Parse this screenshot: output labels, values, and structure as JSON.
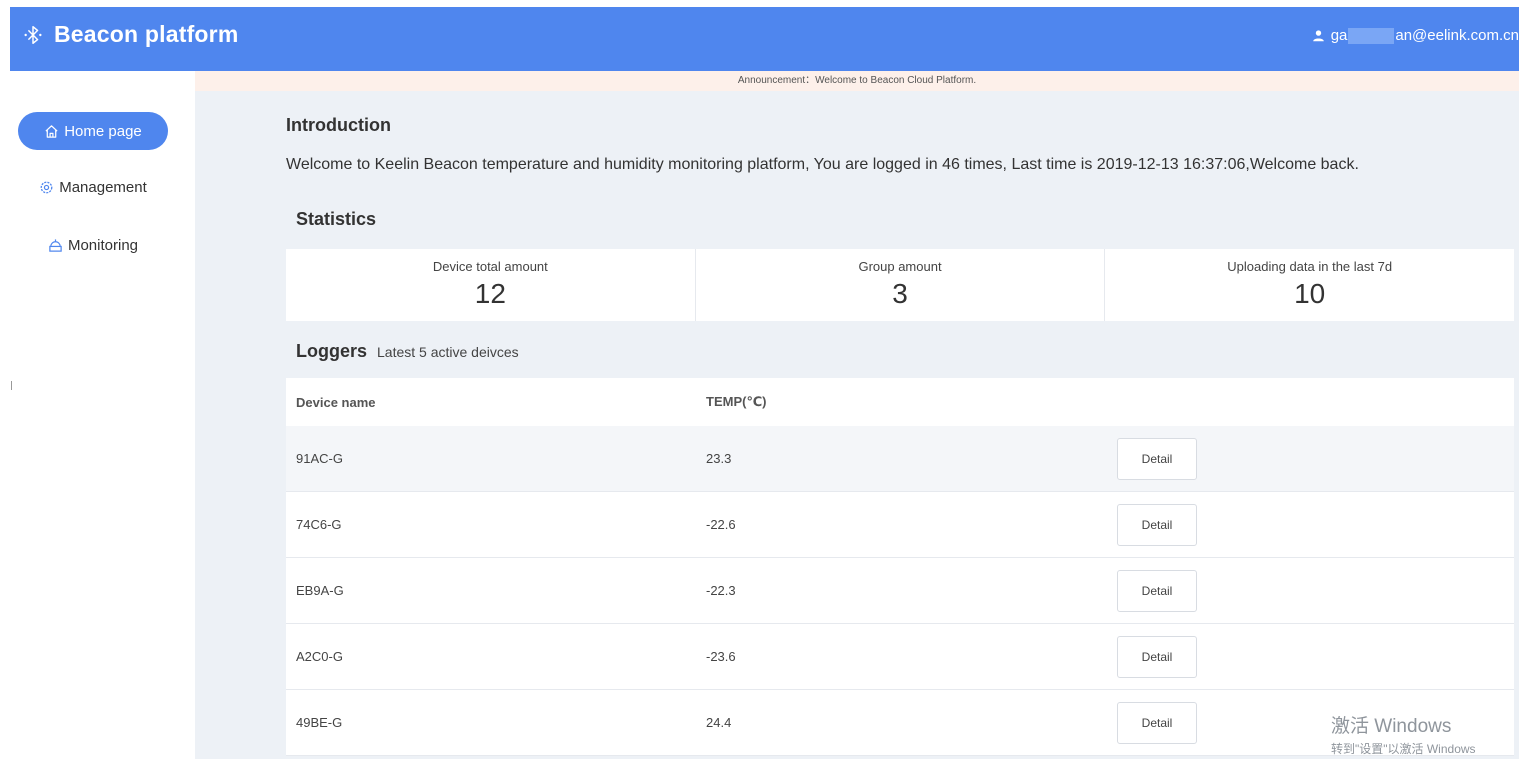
{
  "header": {
    "title": "Beacon platform",
    "user_prefix": "ga",
    "user_suffix": "an@eelink.com.cn"
  },
  "announcement": "Announcement：Welcome to Beacon Cloud Platform.",
  "sidebar": {
    "items": [
      {
        "label": "Home page",
        "icon": "home-icon",
        "active": true
      },
      {
        "label": "Management",
        "icon": "gear-icon",
        "active": false
      },
      {
        "label": "Monitoring",
        "icon": "monitor-icon",
        "active": false
      }
    ]
  },
  "intro": {
    "title": "Introduction",
    "text": "Welcome to Keelin Beacon temperature and humidity monitoring platform, You are logged in 46 times, Last time is 2019-12-13 16:37:06,Welcome back."
  },
  "statistics": {
    "title": "Statistics",
    "cards": [
      {
        "label": "Device total amount",
        "value": "12"
      },
      {
        "label": "Group amount",
        "value": "3"
      },
      {
        "label": "Uploading data in the last 7d",
        "value": "10"
      }
    ]
  },
  "loggers": {
    "title": "Loggers",
    "subtitle": "Latest 5 active deivces",
    "columns": [
      "Device name",
      "TEMP(℃)"
    ],
    "rows": [
      {
        "name": "91AC-G",
        "temp": "23.3",
        "action": "Detail"
      },
      {
        "name": "74C6-G",
        "temp": "-22.6",
        "action": "Detail"
      },
      {
        "name": "EB9A-G",
        "temp": "-22.3",
        "action": "Detail"
      },
      {
        "name": "A2C0-G",
        "temp": "-23.6",
        "action": "Detail"
      },
      {
        "name": "49BE-G",
        "temp": "24.4",
        "action": "Detail"
      }
    ]
  },
  "watermark": {
    "line1": "激活 Windows",
    "line2": "转到\"设置\"以激活 Windows"
  }
}
